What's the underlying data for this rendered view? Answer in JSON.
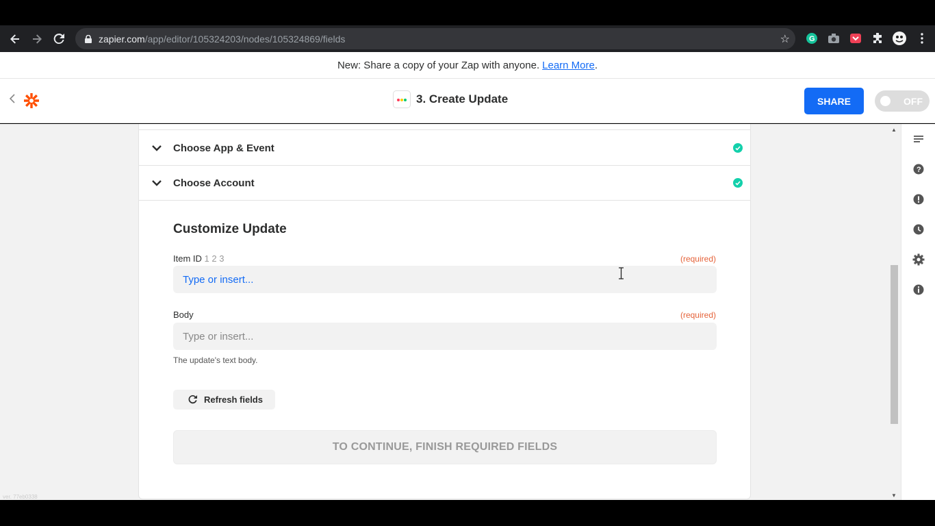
{
  "browser": {
    "url_domain": "zapier.com",
    "url_path": "/app/editor/105324203/nodes/105324869/fields"
  },
  "banner": {
    "text": "New: Share a copy of your Zap with anyone.",
    "link": "Learn More",
    "suffix": "."
  },
  "header": {
    "step_title": "3. Create Update",
    "share_label": "SHARE",
    "toggle_label": "OFF"
  },
  "sections": [
    {
      "label": "Choose App & Event"
    },
    {
      "label": "Choose Account"
    }
  ],
  "form": {
    "title": "Customize Update",
    "fields": [
      {
        "label": "Item ID",
        "ids": "1 2 3",
        "required": "(required)",
        "placeholder": "Type or insert..."
      },
      {
        "label": "Body",
        "required": "(required)",
        "placeholder": "Type or insert...",
        "help": "The update's text body."
      }
    ],
    "refresh_label": "Refresh fields",
    "continue_label": "TO CONTINUE, FINISH REQUIRED FIELDS"
  },
  "version": "ver. 77eb0338",
  "colors": {
    "brand_orange": "#ff4f00",
    "share_blue": "#136bf5",
    "check_green": "#13d0ab",
    "required_orange": "#e56239"
  }
}
